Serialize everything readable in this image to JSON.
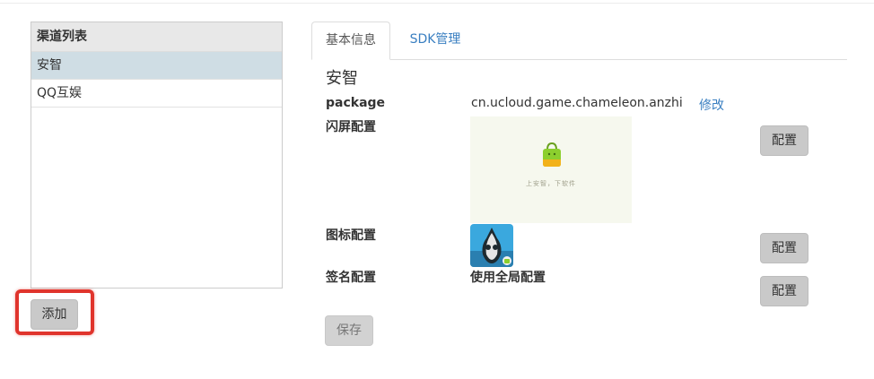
{
  "channel_list": {
    "header": "渠道列表",
    "items": [
      "安智",
      "QQ互娱"
    ],
    "selected_index": 0,
    "add_label": "添加"
  },
  "tabs": [
    {
      "label": "基本信息",
      "active": true
    },
    {
      "label": "SDK管理",
      "active": false
    }
  ],
  "detail": {
    "channel_name": "安智",
    "package_label": "package",
    "package_value": "cn.ucloud.game.chameleon.anzhi",
    "edit_label": "修改",
    "splash_label": "闪屏配置",
    "splash_caption": "上安智，下软件",
    "icon_label": "图标配置",
    "signing_label": "签名配置",
    "signing_value": "使用全局配置",
    "configure_label": "配置",
    "save_label": "保存"
  },
  "colors": {
    "highlight": "#e0342c",
    "link": "#3a7fc1",
    "selected_row": "#cfdde4",
    "button": "#c9c9c9"
  },
  "icons": [
    "anzhi-bag-icon",
    "chameleon-app-icon"
  ]
}
